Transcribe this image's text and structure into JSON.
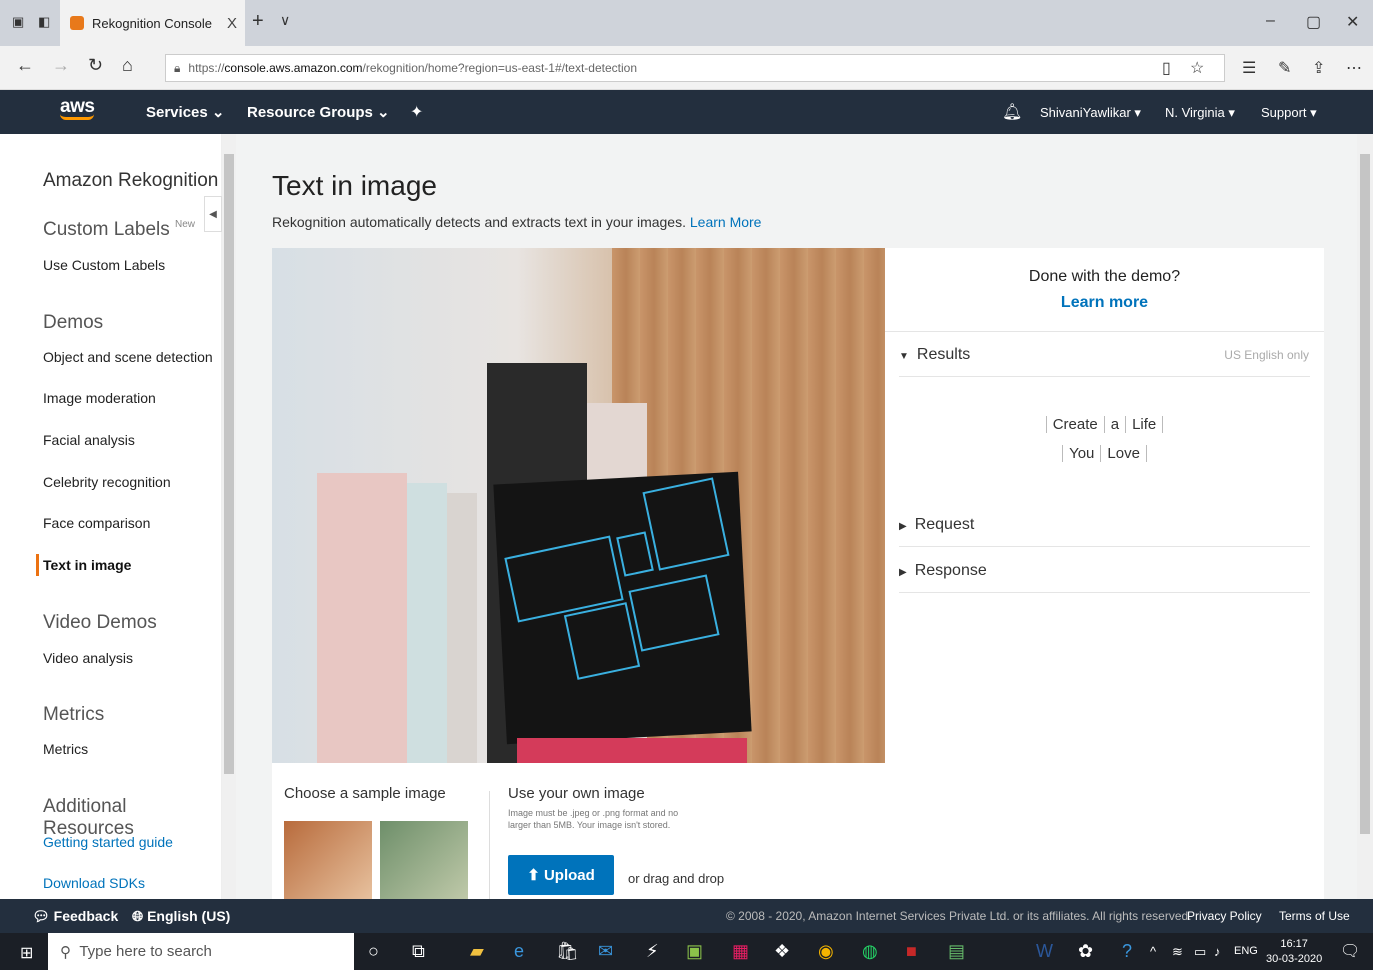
{
  "browser": {
    "tab_title": "Rekognition Console",
    "tab_close": "X",
    "new_tab": "+",
    "url_prefix": "https://",
    "url_domain": "console.aws.amazon.com",
    "url_path": "/rekognition/home?region=us-east-1#/text-detection"
  },
  "aws_nav": {
    "logo": "aws",
    "services": "Services",
    "resource_groups": "Resource Groups",
    "user": "ShivaniYawlikar",
    "region": "N. Virginia",
    "support": "Support"
  },
  "sidebar": {
    "title": "Amazon Rekognition",
    "custom_labels": "Custom Labels",
    "new_badge": "New",
    "use_custom_labels": "Use Custom Labels",
    "demos": "Demos",
    "demo_items": [
      "Object and scene detection",
      "Image moderation",
      "Facial analysis",
      "Celebrity recognition",
      "Face comparison",
      "Text in image"
    ],
    "video_demos": "Video Demos",
    "video_analysis": "Video analysis",
    "metrics_h": "Metrics",
    "metrics": "Metrics",
    "additional": "Additional Resources",
    "getting_started": "Getting started guide",
    "download_sdks": "Download SDKs"
  },
  "main": {
    "title": "Text in image",
    "subtitle": "Rekognition automatically detects and extracts text in your images.",
    "learn_more": "Learn More",
    "choose_sample": "Choose a sample image",
    "use_own": "Use your own image",
    "hint": "Image must be .jpeg or .png format and no larger than 5MB. Your image isn't stored.",
    "upload": "Upload",
    "drag": "or drag and drop"
  },
  "panel": {
    "done": "Done with the demo?",
    "learn_more": "Learn more",
    "results": "Results",
    "us_only": "US English only",
    "line1": [
      "Create",
      "a",
      "Life"
    ],
    "line2": [
      "You",
      "Love"
    ],
    "request": "Request",
    "response": "Response"
  },
  "footer": {
    "feedback": "Feedback",
    "language": "English (US)",
    "copyright": "© 2008 - 2020, Amazon Internet Services Private Ltd. or its affiliates. All rights reserved.",
    "privacy": "Privacy Policy",
    "terms": "Terms of Use"
  },
  "taskbar": {
    "search": "Type here to search",
    "lang": "ENG",
    "time": "16:17",
    "date": "30-03-2020"
  }
}
